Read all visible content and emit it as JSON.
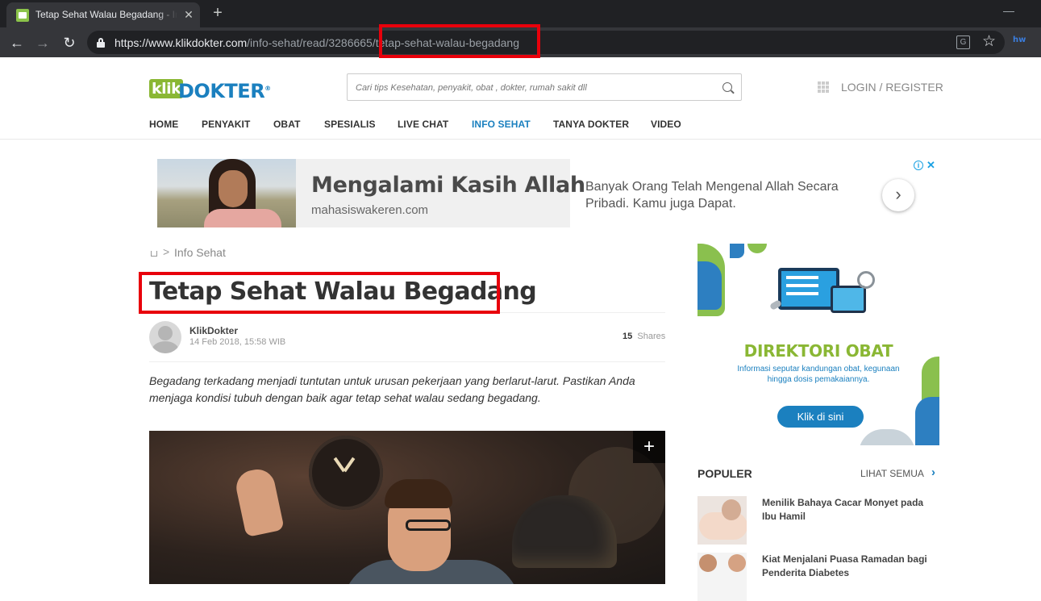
{
  "browser": {
    "tab_title": "Tetap Sehat Walau Begadang - In",
    "url_host": "https://www.klikdokter.com",
    "url_path": "/info-sehat/read/3286665/tetap-sehat-walau-begadang",
    "ext_label": "hw"
  },
  "header": {
    "logo_klik": "klik",
    "logo_dokter": "DOKTER",
    "logo_reg": "®",
    "search_placeholder": "Cari tips Kesehatan, penyakit, obat , dokter, rumah sakit dll",
    "login": "LOGIN / REGISTER"
  },
  "menu": [
    {
      "label": "HOME",
      "active": false
    },
    {
      "label": "PENYAKIT",
      "active": false
    },
    {
      "label": "OBAT",
      "active": false
    },
    {
      "label": "SPESIALIS",
      "active": false
    },
    {
      "label": "LIVE CHAT",
      "active": false
    },
    {
      "label": "INFO SEHAT",
      "active": true
    },
    {
      "label": "TANYA DOKTER",
      "active": false
    },
    {
      "label": "VIDEO",
      "active": false
    }
  ],
  "ad": {
    "headline": "Mengalami Kasih Allah",
    "domain": "mahasiswakeren.com",
    "description": "Banyak Orang Telah Mengenal Allah Secara Pribadi. Kamu juga Dapat.",
    "arrow": "›",
    "choices": "i",
    "close": "✕"
  },
  "breadcrumb": {
    "separator": ">",
    "section": "Info Sehat"
  },
  "article": {
    "title": "Tetap Sehat Walau Begadang",
    "author": "KlikDokter",
    "date": "14 Feb 2018, 15:58 WIB",
    "shares_count": "15",
    "shares_label": "Shares",
    "lead": "Begadang terkadang menjadi tuntutan untuk urusan pekerjaan yang berlarut-larut. Pastikan Anda menjaga kondisi tubuh dengan baik agar tetap sehat walau sedang begadang.",
    "expand": "+"
  },
  "sidebar": {
    "promo_title": "DIREKTORI OBAT",
    "promo_desc": "Informasi seputar kandungan obat, kegunaan hingga dosis pemakaiannya.",
    "promo_button": "Klik di sini",
    "popular_heading": "POPULER",
    "popular_more": "LIHAT SEMUA",
    "popular_chevron": "›",
    "popular_items": [
      {
        "title": "Menilik Bahaya Cacar Monyet pada Ibu Hamil"
      },
      {
        "title": "Kiat Menjalani Puasa Ramadan bagi Penderita Diabetes"
      }
    ]
  },
  "colors": {
    "brand_green": "#8ab734",
    "brand_blue": "#1b80bf",
    "annotation_red": "#e8000b"
  }
}
